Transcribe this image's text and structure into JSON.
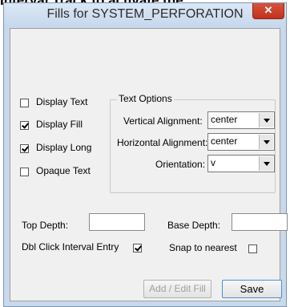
{
  "page_caption": "Interval Track to activate the",
  "window": {
    "title": "Fills for SYSTEM_PERFORATION",
    "close_symbol": "✕"
  },
  "options": {
    "display_text": {
      "label": "Display Text",
      "checked": false
    },
    "display_fill": {
      "label": "Display Fill",
      "checked": true
    },
    "display_long": {
      "label": "Display Long",
      "checked": true
    },
    "opaque_text": {
      "label": "Opaque Text",
      "checked": false
    }
  },
  "text_options": {
    "title": "Text Options",
    "vertical_alignment": {
      "label": "Vertical Alignment:",
      "value": "center"
    },
    "horizontal_alignment": {
      "label": "Horizontal Alignment:",
      "value": "center"
    },
    "orientation": {
      "label": "Orientation:",
      "value": "v"
    }
  },
  "depths": {
    "top_label": "Top Depth:",
    "top_value": "",
    "base_label": "Base Depth:",
    "base_value": ""
  },
  "dbl_click": {
    "label": "Dbl Click Interval Entry",
    "checked": true
  },
  "snap": {
    "label": "Snap to nearest",
    "checked": false
  },
  "buttons": {
    "add_edit": "Add / Edit Fill",
    "save": "Save"
  },
  "colors": {
    "titlebar": "#c9d8ea",
    "client": "#f0f0f0",
    "close": "#c8432b"
  },
  "icons": {
    "close": "close-icon"
  }
}
